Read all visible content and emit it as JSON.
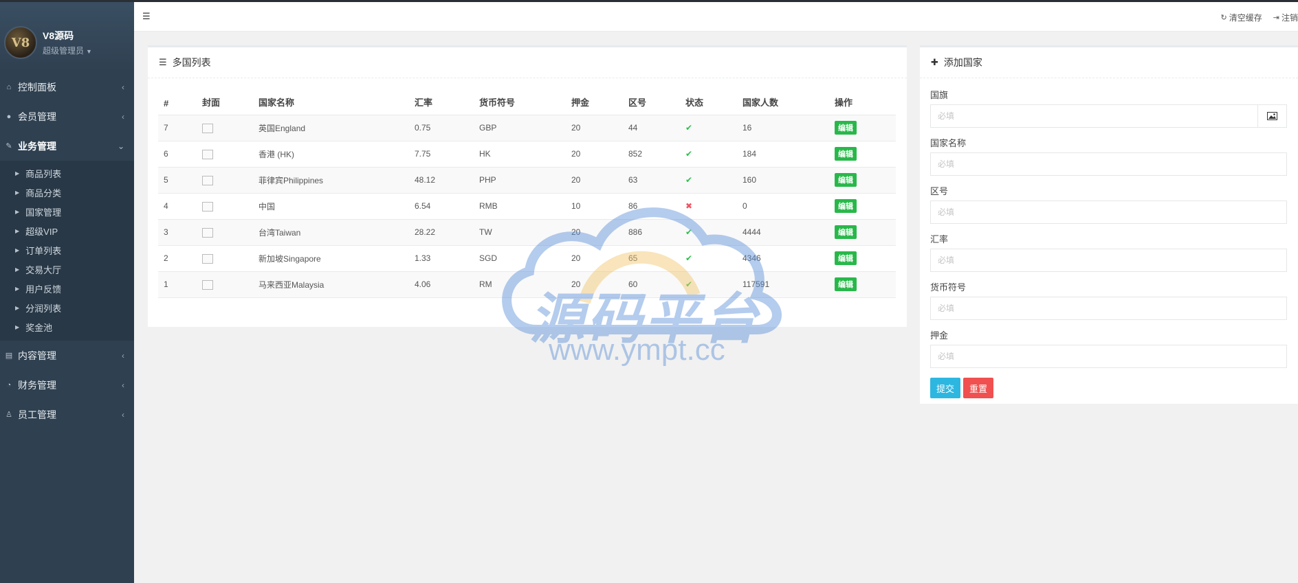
{
  "sidebar": {
    "logo_text": "V8",
    "profile_name": "V8源码",
    "profile_role": "超级管理员",
    "menu": [
      {
        "label": "控制面板"
      },
      {
        "label": "会员管理"
      },
      {
        "label": "业务管理"
      },
      {
        "label": "内容管理"
      },
      {
        "label": "财务管理"
      },
      {
        "label": "员工管理"
      }
    ],
    "submenu": [
      "商品列表",
      "商品分类",
      "国家管理",
      "超级VIP",
      "订单列表",
      "交易大厅",
      "用户反馈",
      "分润列表",
      "奖金池"
    ]
  },
  "topbar": {
    "clear_cache": "清空缓存",
    "logout": "注销"
  },
  "list_panel": {
    "title": "多国列表",
    "headers": [
      "#",
      "封面",
      "国家名称",
      "汇率",
      "货币符号",
      "押金",
      "区号",
      "状态",
      "国家人数",
      "操作"
    ],
    "edit_label": "编辑",
    "rows": [
      {
        "id": "7",
        "name": "英国England",
        "rate": "0.75",
        "symbol": "GBP",
        "deposit": "20",
        "code": "44",
        "status": "ok",
        "people": "16"
      },
      {
        "id": "6",
        "name": "香港 (HK)",
        "rate": "7.75",
        "symbol": "HK",
        "deposit": "20",
        "code": "852",
        "status": "ok",
        "people": "184"
      },
      {
        "id": "5",
        "name": "菲律宾Philippines",
        "rate": "48.12",
        "symbol": "PHP",
        "deposit": "20",
        "code": "63",
        "status": "ok",
        "people": "160"
      },
      {
        "id": "4",
        "name": "中国",
        "rate": "6.54",
        "symbol": "RMB",
        "deposit": "10",
        "code": "86",
        "status": "bad",
        "people": "0"
      },
      {
        "id": "3",
        "name": "台湾Taiwan",
        "rate": "28.22",
        "symbol": "TW",
        "deposit": "20",
        "code": "886",
        "status": "ok",
        "people": "4444"
      },
      {
        "id": "2",
        "name": "新加坡Singapore",
        "rate": "1.33",
        "symbol": "SGD",
        "deposit": "20",
        "code": "65",
        "status": "ok",
        "people": "4346"
      },
      {
        "id": "1",
        "name": "马来西亚Malaysia",
        "rate": "4.06",
        "symbol": "RM",
        "deposit": "20",
        "code": "60",
        "status": "ok",
        "people": "117591"
      }
    ]
  },
  "form_panel": {
    "title": "添加国家",
    "fields": [
      {
        "label": "国旗",
        "placeholder": "必填"
      },
      {
        "label": "国家名称",
        "placeholder": "必填"
      },
      {
        "label": "区号",
        "placeholder": "必填"
      },
      {
        "label": "汇率",
        "placeholder": "必填"
      },
      {
        "label": "货币符号",
        "placeholder": "必填"
      },
      {
        "label": "押金",
        "placeholder": "必填"
      }
    ],
    "submit_label": "提交",
    "reset_label": "重置"
  },
  "watermark": {
    "text": "源码平台",
    "url": "www.ympt.cc"
  },
  "colors": {
    "sidebar_bg": "#2f4050",
    "edit_button": "#28b84a",
    "status_ok": "#2dbf4b",
    "status_bad": "#ed5565",
    "submit_button": "#2db7e0",
    "reset_button": "#f0504f"
  }
}
